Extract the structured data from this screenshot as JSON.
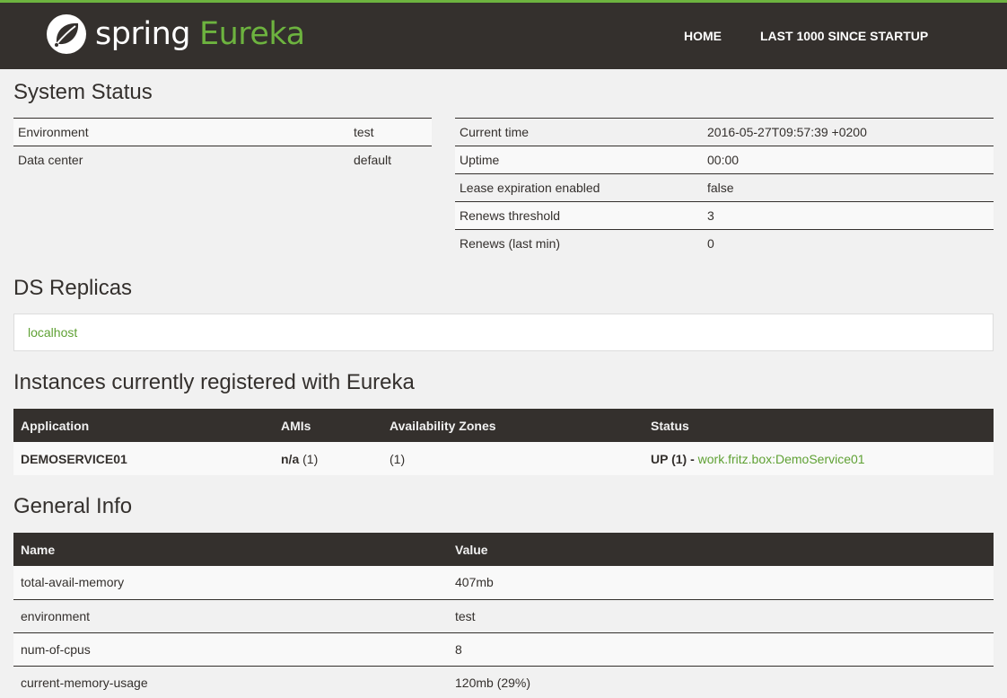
{
  "colors": {
    "brand_green": "#6db33f",
    "navbar_bg": "#34302d",
    "link_green": "#5fa134"
  },
  "header": {
    "logo_icon": "spring-leaf-icon",
    "brand_spring": "spring",
    "brand_eureka": "Eureka",
    "nav": {
      "home": "HOME",
      "last1000": "LAST 1000 SINCE STARTUP"
    }
  },
  "system_status": {
    "title": "System Status",
    "left": [
      {
        "label": "Environment",
        "value": "test"
      },
      {
        "label": "Data center",
        "value": "default"
      }
    ],
    "right": [
      {
        "label": "Current time",
        "value": "2016-05-27T09:57:39 +0200"
      },
      {
        "label": "Uptime",
        "value": "00:00"
      },
      {
        "label": "Lease expiration enabled",
        "value": "false"
      },
      {
        "label": "Renews threshold",
        "value": "3"
      },
      {
        "label": "Renews (last min)",
        "value": "0"
      }
    ]
  },
  "ds_replicas": {
    "title": "DS Replicas",
    "items": [
      "localhost"
    ]
  },
  "instances": {
    "title": "Instances currently registered with Eureka",
    "headers": {
      "application": "Application",
      "amis": "AMIs",
      "zones": "Availability Zones",
      "status": "Status"
    },
    "rows": [
      {
        "application": "DEMOSERVICE01",
        "amis_bold": "n/a",
        "amis_count": " (1)",
        "zones": "(1)",
        "status": "UP (1) - ",
        "status_link": "work.fritz.box:DemoService01"
      }
    ]
  },
  "general_info": {
    "title": "General Info",
    "headers": {
      "name": "Name",
      "value": "Value"
    },
    "rows": [
      {
        "name": "total-avail-memory",
        "value": "407mb"
      },
      {
        "name": "environment",
        "value": "test"
      },
      {
        "name": "num-of-cpus",
        "value": "8"
      },
      {
        "name": "current-memory-usage",
        "value": "120mb (29%)"
      }
    ]
  }
}
